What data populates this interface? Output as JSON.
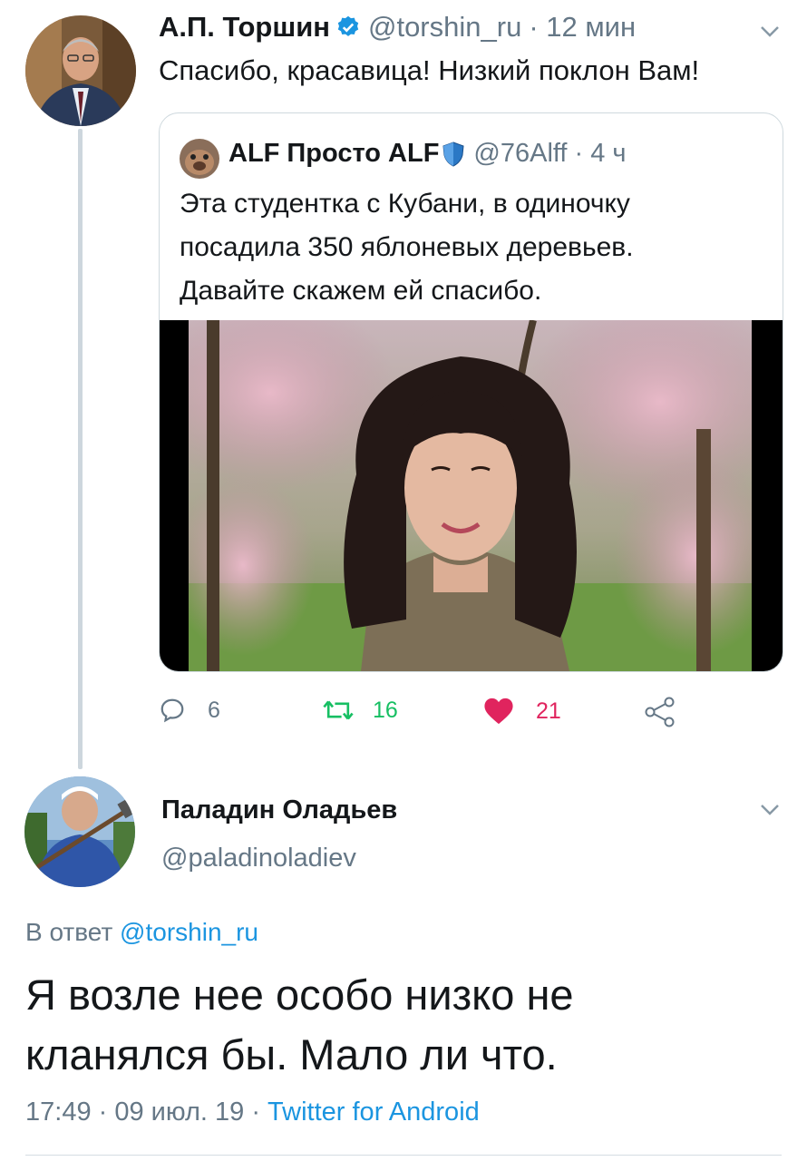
{
  "tweet": {
    "author_name": "А.П. Торшин",
    "handle": "@torshin_ru",
    "time": "· 12 мин",
    "text": "Спасибо, красавица! Низкий поклон Вам!",
    "quoted": {
      "author_name": "ALF Просто ALF",
      "handle": "@76Alff",
      "time": "· 4 ч",
      "text_lines": [
        "Эта студентка с Кубани, в одиночку",
        "посадила 350 яблоневых деревьев.",
        "Давайте скажем ей спасибо."
      ]
    },
    "actions": {
      "replies": "6",
      "retweets": "16",
      "likes": "21"
    }
  },
  "reply": {
    "author_name": "Паладин Оладьев",
    "handle": "@paladinoladiev",
    "in_reply_prefix": "В ответ",
    "in_reply_handle": "@torshin_ru",
    "text_lines": [
      "Я возле нее особо низко не",
      "кланялся бы. Мало ли что."
    ],
    "timestamp": "17:49 · 09 июл. 19 ·",
    "source": "Twitter for Android"
  },
  "colors": {
    "accent_blue": "#1b95e0",
    "retweet_green": "#17bf63",
    "like_red": "#e0245e",
    "secondary_text": "#657786"
  },
  "icons": [
    "verified-badge-icon",
    "chevron-down-icon",
    "reply-icon",
    "retweet-icon",
    "like-icon",
    "share-icon"
  ]
}
